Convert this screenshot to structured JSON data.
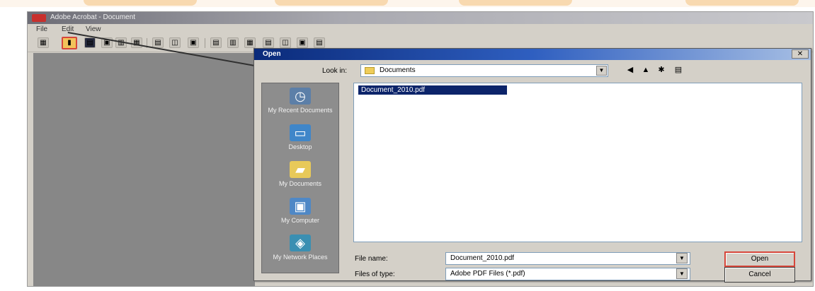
{
  "app": {
    "title": "Adobe Acrobat - Document",
    "menus": [
      "File",
      "Edit",
      "View"
    ]
  },
  "toolbar": {
    "open_glyph": "▮",
    "items": [
      "▦",
      "▤",
      "▣",
      "▥",
      "▦",
      "▤",
      "◫",
      "▣",
      "▤",
      "▥",
      "▦",
      "▤",
      "◫",
      "▣",
      "▤"
    ]
  },
  "dialog": {
    "title": "Open",
    "close": "✕",
    "look_in_label": "Look in:",
    "look_in_value": "Documents",
    "nav": {
      "back": "◀",
      "up": "▲",
      "new_folder": "✱",
      "view": "▤"
    },
    "places": [
      {
        "label": "My Recent Documents",
        "icon": "recent-documents-icon",
        "glyph": "◷",
        "color": "#5c7fa8"
      },
      {
        "label": "Desktop",
        "icon": "desktop-icon",
        "glyph": "▭",
        "color": "#3f86c9"
      },
      {
        "label": "My Documents",
        "icon": "my-documents-icon",
        "glyph": "▰",
        "color": "#e8c959"
      },
      {
        "label": "My Computer",
        "icon": "my-computer-icon",
        "glyph": "▣",
        "color": "#4f88c6"
      },
      {
        "label": "My Network Places",
        "icon": "network-places-icon",
        "glyph": "◈",
        "color": "#3a8fb2"
      }
    ],
    "files": [
      {
        "name": "Document_2010.pdf"
      }
    ],
    "file_name_label": "File name:",
    "file_name_value": "Document_2010.pdf",
    "file_type_label": "Files of type:",
    "file_type_value": "Adobe PDF Files (*.pdf)",
    "open_label": "Open",
    "cancel_label": "Cancel"
  },
  "colors": {
    "highlight": "#d6463a",
    "selection": "#0c246a",
    "titlebar": "#0a2a7a",
    "workspace": "#878787"
  }
}
